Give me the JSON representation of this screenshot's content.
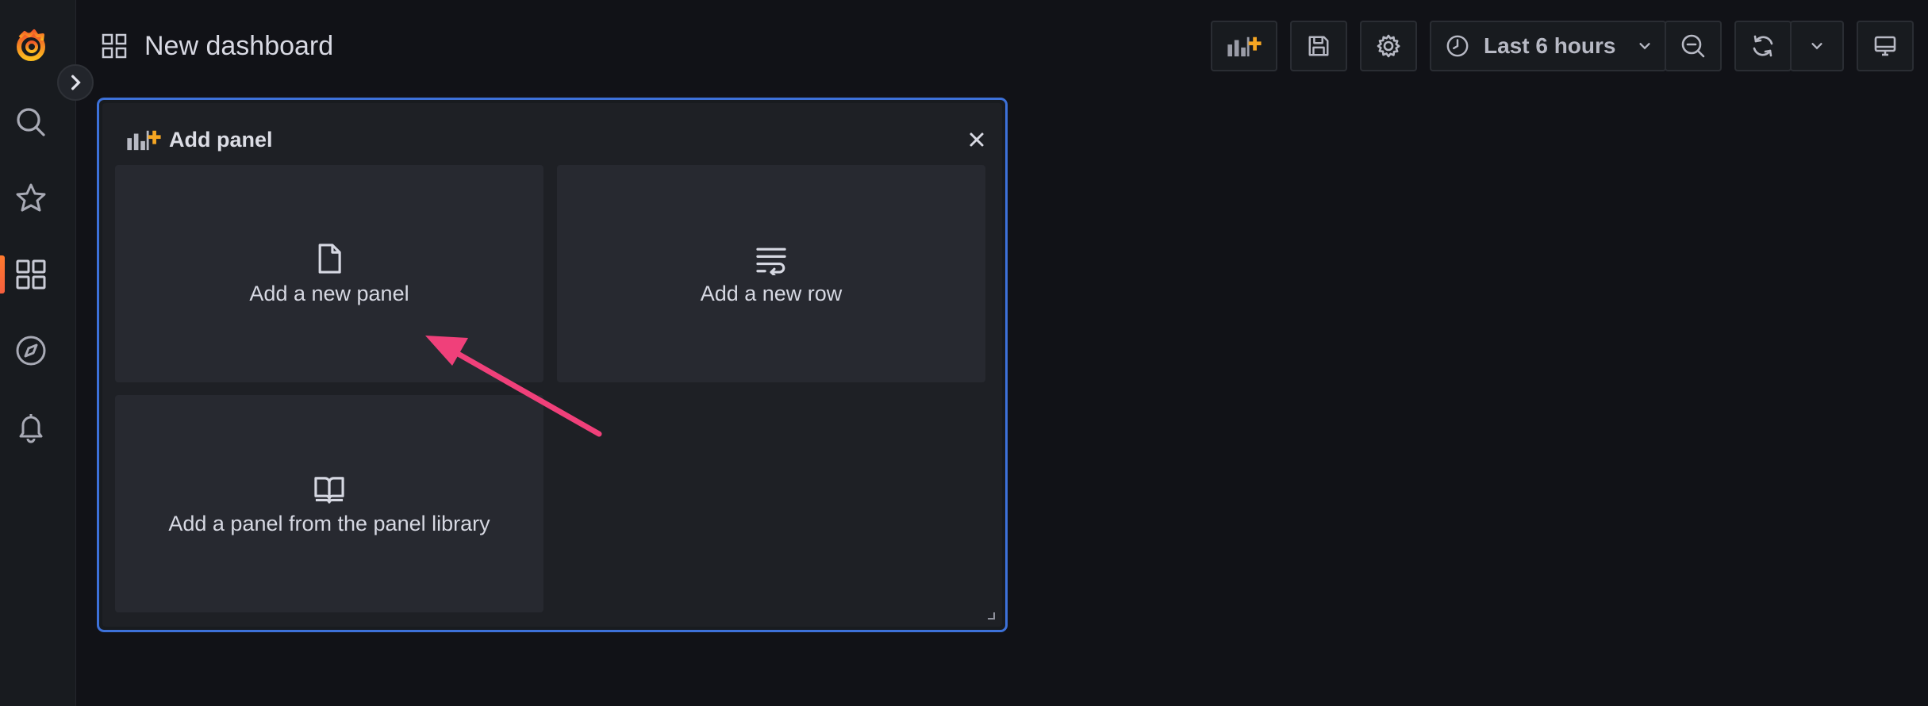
{
  "header": {
    "title": "New dashboard",
    "time_range": "Last 6 hours"
  },
  "sidebar": {
    "items": [
      {
        "name": "grafana-logo"
      },
      {
        "name": "search-icon"
      },
      {
        "name": "star-icon"
      },
      {
        "name": "dashboards-icon",
        "active": true
      },
      {
        "name": "explore-icon"
      },
      {
        "name": "alerting-icon"
      }
    ]
  },
  "add_panel": {
    "title": "Add panel",
    "options": [
      {
        "label": "Add a new panel",
        "icon": "file-icon"
      },
      {
        "label": "Add a new row",
        "icon": "row-icon"
      },
      {
        "label": "Add a panel from the panel library",
        "icon": "book-icon"
      }
    ]
  },
  "colors": {
    "accent": "#f55f3e",
    "panel_border": "#3d71d9",
    "annotation_arrow": "#f0407a",
    "background": "#111217"
  }
}
